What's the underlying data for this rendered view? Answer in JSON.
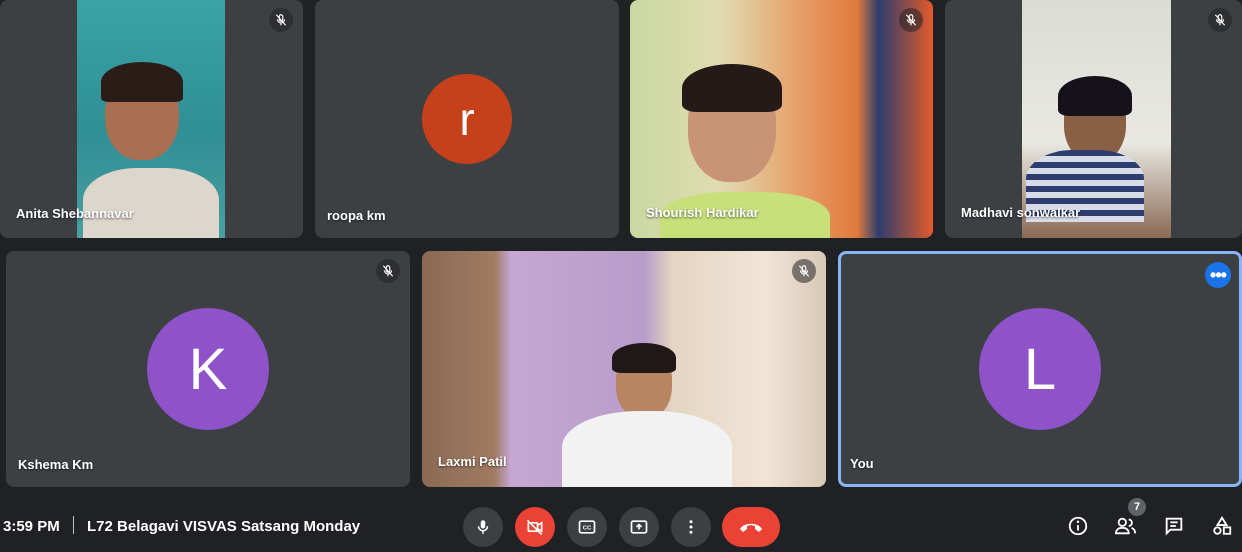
{
  "participants": [
    {
      "name": "Anita Shebannavar",
      "video": true,
      "muted": true
    },
    {
      "name": "roopa km",
      "initial": "r",
      "avatar_color": "#c5401b",
      "video": false,
      "muted": false
    },
    {
      "name": "Shourish Hardikar",
      "video": true,
      "muted": true
    },
    {
      "name": "Madhavi sonwalkar",
      "video": true,
      "muted": true
    },
    {
      "name": "Kshema Km",
      "initial": "K",
      "avatar_color": "#8e53c9",
      "video": false,
      "muted": true
    },
    {
      "name": "Laxmi Patil",
      "video": true,
      "muted": true
    },
    {
      "name": "You",
      "initial": "L",
      "avatar_color": "#8e53c9",
      "video": false,
      "muted": false,
      "active": true
    }
  ],
  "bottom_bar": {
    "time": "3:59 PM",
    "meeting_name": "L72 Belagavi VISVAS Satsang Monday",
    "participant_count": "7"
  },
  "colors": {
    "background": "#202124",
    "tile": "#3c4043",
    "hangup": "#ea4335",
    "accent": "#1a73e8",
    "active_border": "#8ab4f8"
  },
  "icons": [
    "mic-off-icon",
    "microphone-icon",
    "camera-off-icon",
    "captions-icon",
    "present-icon",
    "more-options-icon",
    "hang-up-icon",
    "info-icon",
    "people-icon",
    "chat-icon",
    "activities-icon"
  ]
}
